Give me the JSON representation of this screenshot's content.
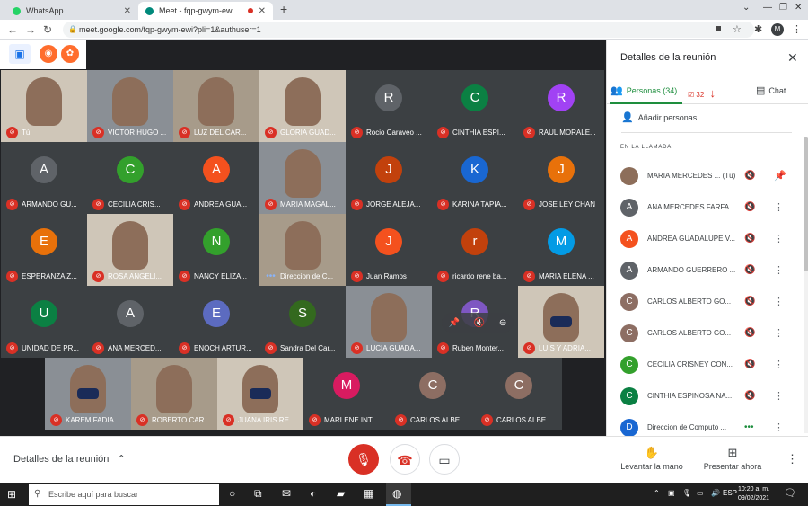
{
  "browser": {
    "tabs": [
      {
        "title": "WhatsApp",
        "favicon_color": "#25d366"
      },
      {
        "title": "Meet - fqp-gwym-ewi",
        "favicon_color": "#00897b"
      }
    ],
    "url": "meet.google.com/fqp-gwym-ewi?pli=1&authuser=1",
    "profile_initial": "M"
  },
  "grid": [
    {
      "label": "Tú",
      "kind": "video"
    },
    {
      "label": "VICTOR HUGO ...",
      "kind": "video"
    },
    {
      "label": "LUZ DEL CAR...",
      "kind": "photo"
    },
    {
      "label": "GLORIA GUAD...",
      "kind": "video"
    },
    {
      "label": "Rocio Caraveo ...",
      "kind": "avatar",
      "initial": "R",
      "color": "#5f6368"
    },
    {
      "label": "CINTHIA ESPI...",
      "kind": "avatar",
      "initial": "C",
      "color": "#0b8043"
    },
    {
      "label": "RAUL MORALE...",
      "kind": "avatar",
      "initial": "R",
      "color": "#a142f4"
    },
    {
      "label": "ARMANDO GU...",
      "kind": "avatar",
      "initial": "A",
      "color": "#5f6368"
    },
    {
      "label": "CECILIA CRIS...",
      "kind": "avatar",
      "initial": "C",
      "color": "#33a02c"
    },
    {
      "label": "ANDREA GUA...",
      "kind": "avatar",
      "initial": "A",
      "color": "#f4511e"
    },
    {
      "label": "MARIA MAGAL...",
      "kind": "photo"
    },
    {
      "label": "JORGE ALEJA...",
      "kind": "avatar",
      "initial": "J",
      "color": "#c2410c"
    },
    {
      "label": "KARINA TAPIA...",
      "kind": "avatar",
      "initial": "K",
      "color": "#1967d2"
    },
    {
      "label": "JOSE LEY CHAN",
      "kind": "avatar",
      "initial": "J",
      "color": "#e8710a"
    },
    {
      "label": "ESPERANZA Z...",
      "kind": "avatar",
      "initial": "E",
      "color": "#e8710a"
    },
    {
      "label": "ROSA ANGELI...",
      "kind": "video"
    },
    {
      "label": "NANCY ELIZA...",
      "kind": "avatar",
      "initial": "N",
      "color": "#33a02c"
    },
    {
      "label": "Direccion de C...",
      "kind": "video",
      "mic_on": true
    },
    {
      "label": "Juan Ramos",
      "kind": "avatar",
      "initial": "J",
      "color": "#f4511e"
    },
    {
      "label": "ricardo rene ba...",
      "kind": "avatar",
      "initial": "r",
      "color": "#c2410c"
    },
    {
      "label": "MARIA ELENA ...",
      "kind": "avatar",
      "initial": "M",
      "color": "#039be5"
    },
    {
      "label": "UNIDAD DE PR...",
      "kind": "avatar",
      "initial": "U",
      "color": "#0b8043"
    },
    {
      "label": "ANA MERCED...",
      "kind": "avatar",
      "initial": "A",
      "color": "#5f6368"
    },
    {
      "label": "ENOCH ARTUR...",
      "kind": "avatar",
      "initial": "E",
      "color": "#5c6bc0"
    },
    {
      "label": "Sandra Del Car...",
      "kind": "avatar",
      "initial": "S",
      "color": "#33691e"
    },
    {
      "label": "LUCIA GUADA...",
      "kind": "video"
    },
    {
      "label": "Ruben Monter...",
      "kind": "avatar",
      "initial": "R",
      "color": "#7e57c2"
    },
    {
      "label": "LUIS Y ADRIA...",
      "kind": "video",
      "mask": true
    },
    {
      "label": "KAREM FADIA...",
      "kind": "video",
      "mask": true
    },
    {
      "label": "ROBERTO CARL...",
      "kind": "video"
    },
    {
      "label": "JUANA IRIS RE...",
      "kind": "video",
      "mask": true
    },
    {
      "label": "MARLENE INT...",
      "kind": "avatar",
      "initial": "M",
      "color": "#d81b60"
    },
    {
      "label": "CARLOS ALBE...",
      "kind": "avatar",
      "initial": "C",
      "color": "#8d6e63"
    },
    {
      "label": "CARLOS ALBE...",
      "kind": "avatar",
      "initial": "C",
      "color": "#8d6e63"
    }
  ],
  "bottom": {
    "meeting_details": "Detalles de la reunión",
    "raise_hand": "Levantar la mano",
    "present_now": "Presentar ahora"
  },
  "panel": {
    "title": "Detalles de la reunión",
    "people_tab": "Personas (34)",
    "chat_tab": "Chat",
    "badge_count": "32",
    "add_people": "Añadir personas",
    "section": "EN LA LLAMADA",
    "people": [
      {
        "name": "MARIA MERCEDES ... (Tú)",
        "initial": "",
        "color": "",
        "photo": true,
        "pin": true
      },
      {
        "name": "ANA MERCEDES FARFA...",
        "initial": "A",
        "color": "#5f6368"
      },
      {
        "name": "ANDREA GUADALUPE V...",
        "initial": "A",
        "color": "#f4511e"
      },
      {
        "name": "ARMANDO GUERRERO ...",
        "initial": "A",
        "color": "#5f6368"
      },
      {
        "name": "CARLOS ALBERTO GO...",
        "initial": "C",
        "color": "#8d6e63"
      },
      {
        "name": "CARLOS ALBERTO GO...",
        "initial": "C",
        "color": "#8d6e63"
      },
      {
        "name": "CECILIA CRISNEY CON...",
        "initial": "C",
        "color": "#33a02c"
      },
      {
        "name": "CINTHIA ESPINOSA NA...",
        "initial": "C",
        "color": "#0b8043"
      },
      {
        "name": "Direccion de Computo ...",
        "initial": "D",
        "color": "#1967d2",
        "speaking": true
      }
    ]
  },
  "taskbar": {
    "search_placeholder": "Escribe aquí para buscar",
    "lang": "ESP",
    "time": "10:20 a. m.",
    "date": "09/02/2021"
  }
}
